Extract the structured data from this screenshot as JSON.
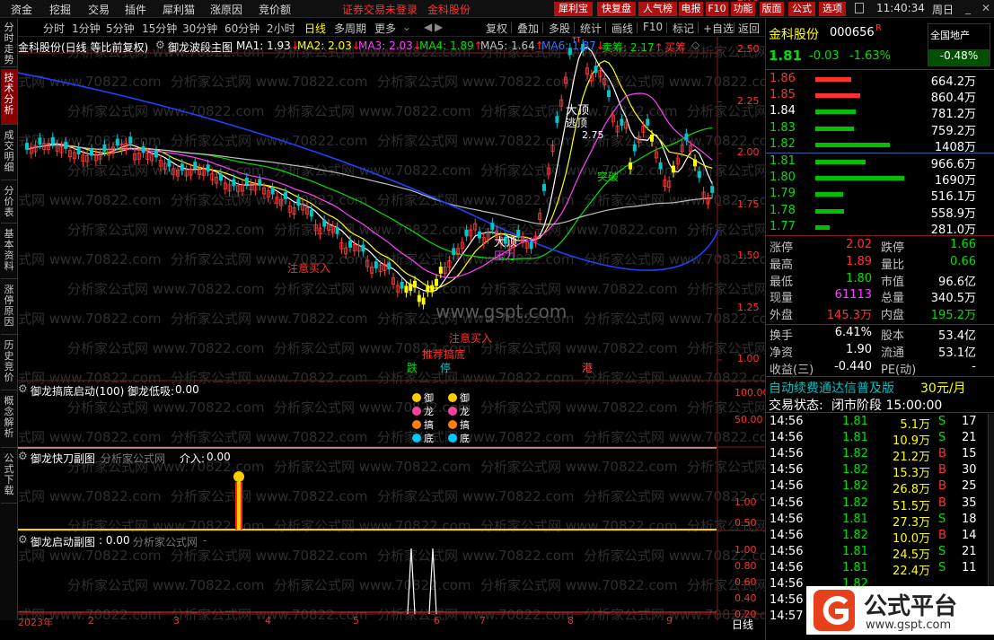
{
  "menubar": {
    "items": [
      "资金",
      "挖掘",
      "交易",
      "插件",
      "犀利猫",
      "涨原因",
      "竞价额"
    ],
    "notice": "证券交易未登录",
    "stock_name": "金科股份",
    "red_buttons": [
      "犀利宝",
      "快复盘",
      "人气榜",
      "电报",
      "F10",
      "功能",
      "版面",
      "公式",
      "选项"
    ],
    "time": "11:40:34",
    "weekday": "周日"
  },
  "toolbar": {
    "items": [
      "分时",
      "1分钟",
      "5分钟",
      "15分钟",
      "30分钟",
      "60分钟",
      "2小时",
      "日线",
      "多周期",
      "更多"
    ],
    "active": "日线",
    "right_items": [
      "复权",
      "叠加",
      "多股",
      "统计",
      "画线",
      "F10",
      "标记",
      "+自选",
      "返回"
    ]
  },
  "lefttabs": [
    "分时走势",
    "技术分析",
    "成交明细",
    "分价表",
    "基本资料",
    "涨停原因",
    "历史竞价",
    "概念解析",
    "公式下载"
  ],
  "main_chart": {
    "title": "金科股份(日线 等比前复权)",
    "indicator": "御龙波段主图",
    "ma_values": [
      {
        "name": "MA1",
        "value": "1.93",
        "arrow": "↓",
        "color": "#ffffff"
      },
      {
        "name": "MA2",
        "value": "2.03",
        "arrow": "↓",
        "color": "#ffff00"
      },
      {
        "name": "MA3",
        "value": "2.03",
        "arrow": "↓",
        "color": "#ff40ff"
      },
      {
        "name": "MA4",
        "value": "1.89",
        "arrow": "↑",
        "color": "#00e000"
      },
      {
        "name": "MA5",
        "value": "1.64",
        "arrow": "↑",
        "color": "#c0c0c0"
      },
      {
        "name": "MA6",
        "value": "1.87",
        "arrow": "↓",
        "color": "#4070ff"
      }
    ],
    "sell_label": "卖筹",
    "sell_value": "2.17",
    "buy_label": "买筹",
    "y_ticks": [
      "3.00",
      "2.75",
      "2.50",
      "2.25",
      "2.00",
      "1.75",
      "1.50",
      "1.25",
      "1.00"
    ],
    "annotations": {
      "top": "大顶",
      "escape": "逃顶",
      "high_price": "2.75",
      "pressure": "压力",
      "support": "支撑",
      "break": "突破",
      "attention": "注意买入",
      "recommend": "推荐搞底",
      "fall": "跌",
      "stop": "停",
      "port": "港"
    },
    "watermark_text": "分析家公式网 www.70822.com",
    "gspt": "www.gspt.com"
  },
  "sub1": {
    "title": "御龙搞底启动(100)",
    "label": "御龙低吸:",
    "value": "0.00",
    "y_ticks": [
      "100.00",
      "50.00"
    ],
    "icons": [
      "御",
      "龙",
      "搞",
      "底"
    ]
  },
  "sub2": {
    "title": "御龙快刀副图",
    "source": "分析家公式网",
    "label": "介入:",
    "value": "0.00",
    "y_ticks": [
      "1.00",
      "0.50"
    ]
  },
  "sub3": {
    "title": "御龙启动副图",
    "value": ": 0.00",
    "source": "分析家公式网",
    "suffix": "-",
    "y_ticks": [
      "1.00",
      "0.80",
      "0.60",
      "0.40",
      "0.20"
    ]
  },
  "date_axis": {
    "labels": [
      "2023年",
      "2",
      "3",
      "4",
      "5",
      "6",
      "7",
      "8",
      "9"
    ],
    "period": "日线"
  },
  "quote": {
    "name": "金科股份",
    "code": "000656",
    "flag": "R",
    "sector_label": "全国地产",
    "sector_change": "-0.48%",
    "price": "1.81",
    "change": "-0.03",
    "pct": "-1.63%",
    "asks": [
      {
        "price": "1.86",
        "vol": "664.2万",
        "bar": 0.22
      },
      {
        "price": "1.85",
        "vol": "860.4万",
        "bar": 0.28
      },
      {
        "price": "1.84",
        "vol": "781.2万",
        "bar": 0.25
      },
      {
        "price": "1.83",
        "vol": "759.2万",
        "bar": 0.24
      },
      {
        "price": "1.82",
        "vol": "1408万",
        "bar": 0.46
      }
    ],
    "bids": [
      {
        "price": "1.81",
        "vol": "966.6万",
        "bar": 0.31
      },
      {
        "price": "1.80",
        "vol": "1690万",
        "bar": 0.55
      },
      {
        "price": "1.79",
        "vol": "516.1万",
        "bar": 0.17
      },
      {
        "price": "1.78",
        "vol": "558.9万",
        "bar": 0.18
      },
      {
        "price": "1.77",
        "vol": "281.0万",
        "bar": 0.09
      }
    ],
    "stats": [
      {
        "l1": "涨停",
        "v1": "2.02",
        "c1": "red",
        "l2": "跌停",
        "v2": "1.66",
        "c2": "grn"
      },
      {
        "l1": "最高",
        "v1": "1.89",
        "c1": "red",
        "l2": "量比",
        "v2": "0.66",
        "c2": "grn"
      },
      {
        "l1": "最低",
        "v1": "1.80",
        "c1": "grn",
        "l2": "市值",
        "v2": "96.6亿",
        "c2": "wht"
      },
      {
        "l1": "现量",
        "v1": "61113",
        "c1": "mag",
        "l2": "总量",
        "v2": "340.5万",
        "c2": "wht"
      },
      {
        "l1": "外盘",
        "v1": "145.3万",
        "c1": "red",
        "l2": "内盘",
        "v2": "195.2万",
        "c2": "grn"
      }
    ],
    "stats2": [
      {
        "l1": "换手",
        "v1": "6.41%",
        "l2": "股本",
        "v2": "53.4亿"
      },
      {
        "l1": "净资",
        "v1": "1.90",
        "l2": "流通",
        "v2": "53.1亿"
      },
      {
        "l1": "收益(三)",
        "v1": "-0.440",
        "l2": "PE(动)",
        "v2": "-"
      }
    ],
    "promo": "自动续费通达信普及版",
    "promo_price": "30元/月",
    "trade_state_label": "交易状态:",
    "trade_state": "闭市阶段 15:00:00"
  },
  "ticks": [
    {
      "t": "14:56",
      "p": "1.81",
      "pc": "grn",
      "v": "5.1万",
      "s": "S",
      "n": "17"
    },
    {
      "t": "14:56",
      "p": "1.81",
      "pc": "grn",
      "v": "10.9万",
      "s": "S",
      "n": "21"
    },
    {
      "t": "14:56",
      "p": "1.82",
      "pc": "grn",
      "v": "21.2万",
      "s": "B",
      "n": "15"
    },
    {
      "t": "14:56",
      "p": "1.82",
      "pc": "grn",
      "v": "15.3万",
      "s": "B",
      "n": "30"
    },
    {
      "t": "14:56",
      "p": "1.82",
      "pc": "grn",
      "v": "26.8万",
      "s": "B",
      "n": "25"
    },
    {
      "t": "14:56",
      "p": "1.82",
      "pc": "grn",
      "v": "51.5万",
      "s": "B",
      "n": "35"
    },
    {
      "t": "14:56",
      "p": "1.81",
      "pc": "grn",
      "v": "27.3万",
      "s": "S",
      "n": "18"
    },
    {
      "t": "14:56",
      "p": "1.82",
      "pc": "grn",
      "v": "10.0万",
      "s": "B",
      "n": "14"
    },
    {
      "t": "14:56",
      "p": "1.81",
      "pc": "grn",
      "v": "24.5万",
      "s": "S",
      "n": "21"
    },
    {
      "t": "14:56",
      "p": "1.81",
      "pc": "grn",
      "v": "22.4万",
      "s": "S",
      "n": "11"
    },
    {
      "t": "14:56",
      "p": "1.82",
      "pc": "grn",
      "v": "",
      "s": "",
      "n": ""
    },
    {
      "t": "14:56",
      "p": "",
      "pc": "grn",
      "v": "",
      "s": "",
      "n": ""
    },
    {
      "t": "14:57",
      "p": "",
      "pc": "grn",
      "v": "",
      "s": "",
      "n": ""
    }
  ],
  "watermark": {
    "brand": "公式平台",
    "url": "www.gspt.com"
  }
}
